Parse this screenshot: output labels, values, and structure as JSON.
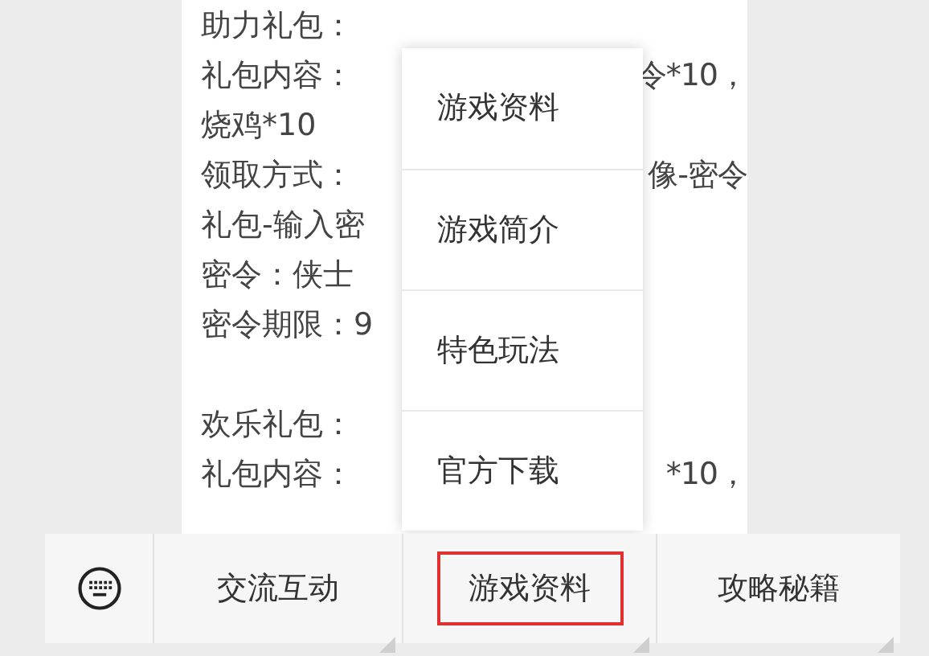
{
  "sections": [
    {
      "lines": [
        {
          "left": "助力礼包："
        },
        {
          "left": "礼包内容：",
          "right": "令*10，"
        },
        {
          "left": "烧鸡*10"
        },
        {
          "left": "领取方式：",
          "right": "像-密令"
        },
        {
          "left": "礼包-输入密"
        },
        {
          "left": "密令：侠士"
        },
        {
          "left": "密令期限：9"
        }
      ]
    },
    {
      "lines": [
        {
          "left": "欢乐礼包："
        },
        {
          "left": "礼包内容：",
          "right": "*10，"
        }
      ]
    }
  ],
  "popup_menu": {
    "items": [
      "游戏资料",
      "游戏简介",
      "特色玩法",
      "官方下载"
    ]
  },
  "bottom_bar": {
    "tabs": [
      {
        "label": "交流互动",
        "selected": false
      },
      {
        "label": "游戏资料",
        "selected": true
      },
      {
        "label": "攻略秘籍",
        "selected": false
      }
    ]
  }
}
